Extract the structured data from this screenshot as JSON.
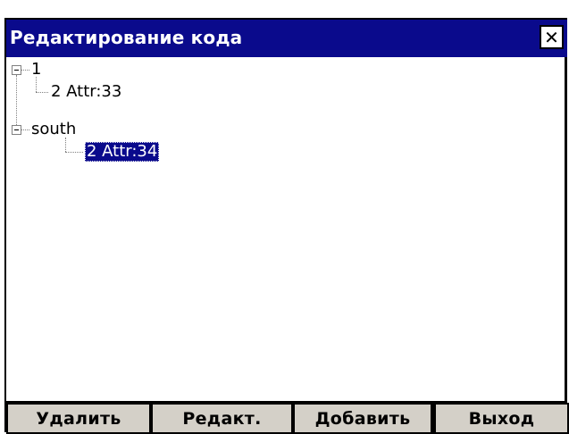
{
  "window": {
    "title": "Редактирование кода",
    "close_glyph": "✕"
  },
  "tree": {
    "nodes": [
      {
        "label": "1",
        "expanded": true
      },
      {
        "label": "2  Attr:33",
        "parent": "1"
      },
      {
        "label": "south",
        "expanded": true
      },
      {
        "label": "2  Attr:34",
        "parent": "south",
        "selected": true
      }
    ]
  },
  "buttons": {
    "delete": "Удалить",
    "edit": "Редакт.",
    "add": "Добавить",
    "exit": "Выход"
  },
  "colors": {
    "titlebar": "#0a0a8c",
    "selection": "#0a0a8c",
    "button_face": "#d4d0c8"
  }
}
